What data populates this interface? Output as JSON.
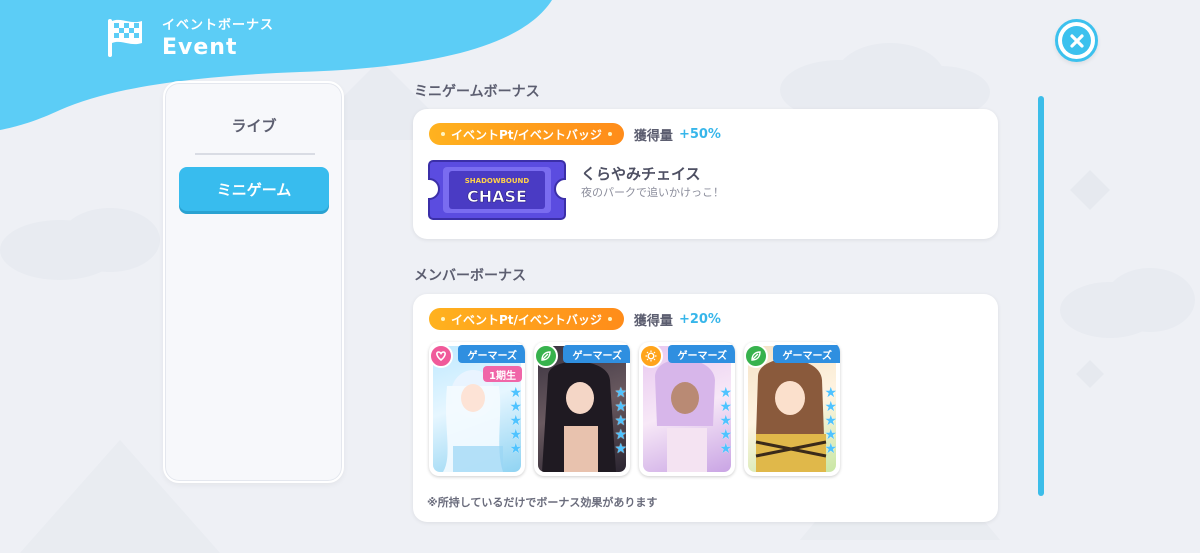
{
  "header": {
    "subtitle": "イベントボーナス",
    "title": "Event",
    "icon": "checkered-flag-icon"
  },
  "close_icon": "close-icon",
  "sidebar": {
    "items": [
      {
        "label": "ライブ",
        "selected": false
      },
      {
        "label": "ミニゲーム",
        "selected": true
      }
    ]
  },
  "minigame_section": {
    "title": "ミニゲームボーナス",
    "badge": "イベントPt/イベントバッジ",
    "gain_label": "獲得量",
    "gain_value": "+50%",
    "game_logo_text": "SHADOWBOUND CHASE",
    "game_name": "くらやみチェイス",
    "game_desc": "夜のパークで追いかけっこ！"
  },
  "member_section": {
    "title": "メンバーボーナス",
    "badge": "イベントPt/イベントバッジ",
    "gain_label": "獲得量",
    "gain_value": "+20%",
    "cards": [
      {
        "tag": "ゲーマーズ",
        "attr_color": "#f05a9a",
        "attr_icon": "heart-icon",
        "gen": "1期生",
        "stars": 5
      },
      {
        "tag": "ゲーマーズ",
        "attr_color": "#37b24d",
        "attr_icon": "leaf-icon",
        "gen": "",
        "stars": 5
      },
      {
        "tag": "ゲーマーズ",
        "attr_color": "#ffa41b",
        "attr_icon": "sun-icon",
        "gen": "",
        "stars": 5
      },
      {
        "tag": "ゲーマーズ",
        "attr_color": "#37b24d",
        "attr_icon": "leaf-icon",
        "gen": "",
        "stars": 5
      }
    ],
    "note": "※所持しているだけでボーナス効果があります"
  },
  "colors": {
    "accent": "#3cc1ee",
    "badge": "#ff9e1b",
    "header_bg": "#5ccdf6"
  }
}
